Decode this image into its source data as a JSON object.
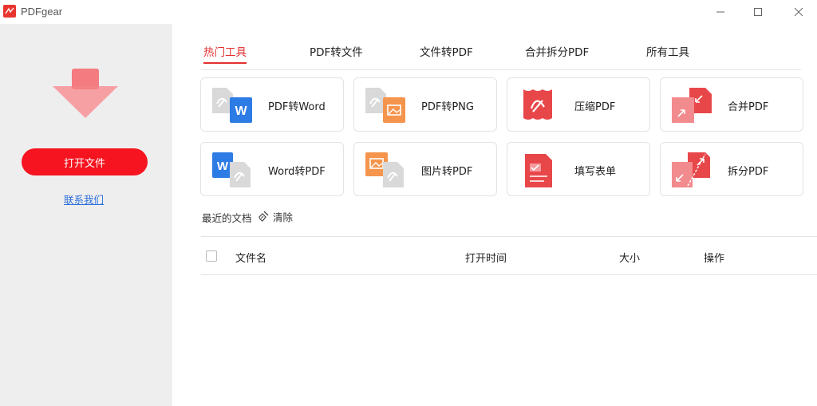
{
  "window": {
    "title": "PDFgear"
  },
  "sidebar": {
    "open_button": "打开文件",
    "contact_link": "联系我们"
  },
  "tabs": [
    {
      "label": "热门工具",
      "active": true
    },
    {
      "label": "PDF转文件",
      "active": false
    },
    {
      "label": "文件转PDF",
      "active": false
    },
    {
      "label": "合并拆分PDF",
      "active": false
    },
    {
      "label": "所有工具",
      "active": false
    }
  ],
  "tools": [
    {
      "label": "PDF转Word",
      "icon": "pdf-to-word-icon"
    },
    {
      "label": "PDF转PNG",
      "icon": "pdf-to-png-icon"
    },
    {
      "label": "压缩PDF",
      "icon": "compress-pdf-icon"
    },
    {
      "label": "合并PDF",
      "icon": "merge-pdf-icon"
    },
    {
      "label": "Word转PDF",
      "icon": "word-to-pdf-icon"
    },
    {
      "label": "图片转PDF",
      "icon": "image-to-pdf-icon"
    },
    {
      "label": "填写表单",
      "icon": "fill-form-icon"
    },
    {
      "label": "拆分PDF",
      "icon": "split-pdf-icon"
    }
  ],
  "recent": {
    "label": "最近的文档",
    "clear_label": "清除"
  },
  "table": {
    "columns": [
      "文件名",
      "打开时间",
      "大小",
      "操作"
    ]
  },
  "colors": {
    "accent": "#f5141f",
    "link": "#2a6fdb",
    "sidebar_bg": "#eeeeee"
  }
}
